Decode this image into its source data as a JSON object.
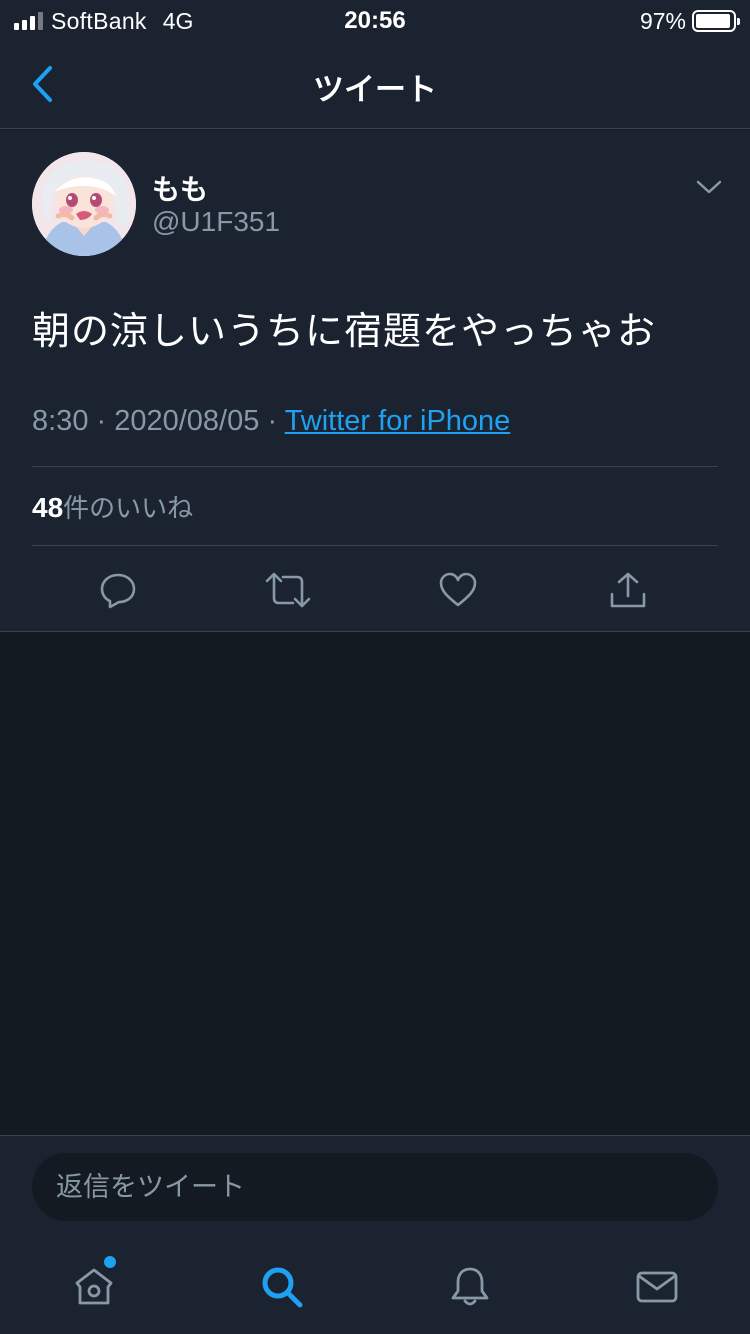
{
  "status_bar": {
    "carrier": "SoftBank",
    "network": "4G",
    "time": "20:56",
    "battery_percent": "97%"
  },
  "nav": {
    "title": "ツイート",
    "back_icon": "chevron-left-icon"
  },
  "tweet": {
    "display_name": "もも",
    "handle": "@U1F351",
    "text": "朝の涼しいうちに宿題をやっちゃお",
    "time": "8:30",
    "separator": " · ",
    "date": "2020/08/05",
    "source": "Twitter for iPhone",
    "likes_count": "48",
    "likes_label": "件のいいね",
    "actions": [
      "reply-icon",
      "retweet-icon",
      "like-icon",
      "share-icon"
    ]
  },
  "reply": {
    "placeholder": "返信をツイート"
  },
  "tab_bar": {
    "items": [
      "home-icon",
      "search-icon",
      "notifications-icon",
      "messages-icon"
    ],
    "active": "search-icon",
    "home_has_new_dot": true
  },
  "colors": {
    "background": "#141a22",
    "surface": "#1b2330",
    "accent": "#1da1f2",
    "secondary_text": "#8899a6",
    "border": "#38444d"
  }
}
